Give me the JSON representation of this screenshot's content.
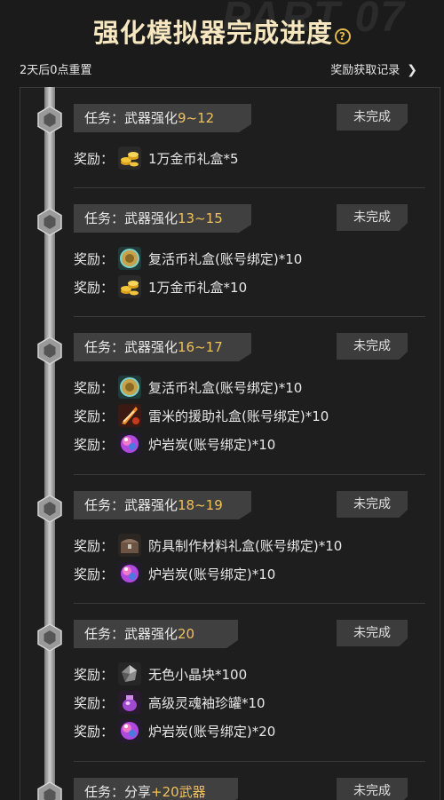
{
  "header": {
    "title": "强化模拟器完成进度",
    "help_icon": "question-circle-icon",
    "watermark": "PART 07",
    "reset_text": "2天后0点重置",
    "records_label": "奖励获取记录"
  },
  "colors": {
    "accent": "#f0c15a",
    "title": "#f6e7c1"
  },
  "tasks": [
    {
      "prefix": "任务：武器强化",
      "level": "9~12",
      "status": "未完成",
      "rewards": [
        {
          "label": "奖励：",
          "item": "1万金币礼盒*5",
          "icon": "gold-coins-icon"
        }
      ]
    },
    {
      "prefix": "任务：武器强化",
      "level": "13~15",
      "status": "未完成",
      "rewards": [
        {
          "label": "奖励：",
          "item": "复活币礼盒(账号绑定)*10",
          "icon": "revive-coin-icon"
        },
        {
          "label": "奖励：",
          "item": "1万金币礼盒*10",
          "icon": "gold-coins-icon"
        }
      ]
    },
    {
      "prefix": "任务：武器强化",
      "level": "16~17",
      "status": "未完成",
      "rewards": [
        {
          "label": "奖励：",
          "item": "复活币礼盒(账号绑定)*10",
          "icon": "revive-coin-icon"
        },
        {
          "label": "奖励：",
          "item": "雷米的援助礼盒(账号绑定)*10",
          "icon": "remy-aid-icon"
        },
        {
          "label": "奖励：",
          "item": "炉岩炭(账号绑定)*10",
          "icon": "furnace-coal-icon"
        }
      ]
    },
    {
      "prefix": "任务：武器强化",
      "level": "18~19",
      "status": "未完成",
      "rewards": [
        {
          "label": "奖励：",
          "item": "防具制作材料礼盒(账号绑定)*10",
          "icon": "armor-material-chest-icon"
        },
        {
          "label": "奖励：",
          "item": "炉岩炭(账号绑定)*10",
          "icon": "furnace-coal-icon"
        }
      ]
    },
    {
      "prefix": "任务：武器强化",
      "level": "20",
      "status": "未完成",
      "rewards": [
        {
          "label": "奖励：",
          "item": "无色小晶块*100",
          "icon": "colorless-crystal-icon"
        },
        {
          "label": "奖励：",
          "item": "高级灵魂袖珍罐*10",
          "icon": "soul-jar-icon"
        },
        {
          "label": "奖励：",
          "item": "炉岩炭(账号绑定)*20",
          "icon": "furnace-coal-icon"
        }
      ]
    },
    {
      "prefix": "任务：分享",
      "level": "+20武器",
      "status": "未完成",
      "rewards": []
    }
  ]
}
